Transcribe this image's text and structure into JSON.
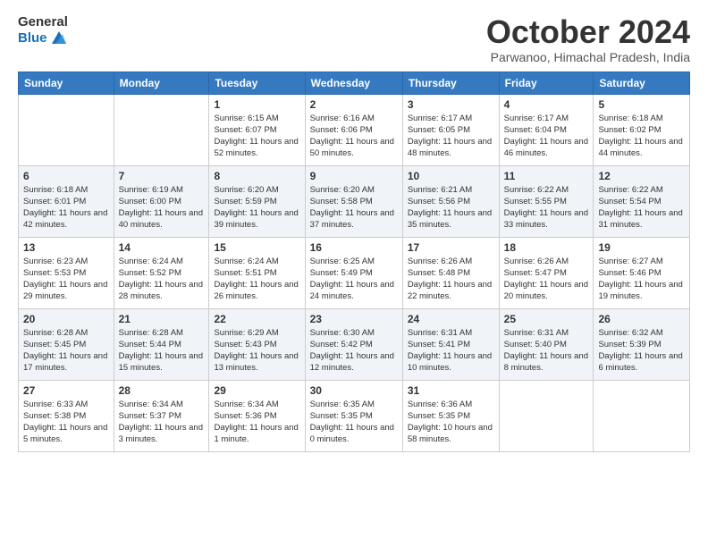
{
  "logo": {
    "general": "General",
    "blue": "Blue"
  },
  "header": {
    "month": "October 2024",
    "location": "Parwanoo, Himachal Pradesh, India"
  },
  "weekdays": [
    "Sunday",
    "Monday",
    "Tuesday",
    "Wednesday",
    "Thursday",
    "Friday",
    "Saturday"
  ],
  "weeks": [
    [
      {
        "day": "",
        "sunrise": "",
        "sunset": "",
        "daylight": ""
      },
      {
        "day": "",
        "sunrise": "",
        "sunset": "",
        "daylight": ""
      },
      {
        "day": "1",
        "sunrise": "Sunrise: 6:15 AM",
        "sunset": "Sunset: 6:07 PM",
        "daylight": "Daylight: 11 hours and 52 minutes."
      },
      {
        "day": "2",
        "sunrise": "Sunrise: 6:16 AM",
        "sunset": "Sunset: 6:06 PM",
        "daylight": "Daylight: 11 hours and 50 minutes."
      },
      {
        "day": "3",
        "sunrise": "Sunrise: 6:17 AM",
        "sunset": "Sunset: 6:05 PM",
        "daylight": "Daylight: 11 hours and 48 minutes."
      },
      {
        "day": "4",
        "sunrise": "Sunrise: 6:17 AM",
        "sunset": "Sunset: 6:04 PM",
        "daylight": "Daylight: 11 hours and 46 minutes."
      },
      {
        "day": "5",
        "sunrise": "Sunrise: 6:18 AM",
        "sunset": "Sunset: 6:02 PM",
        "daylight": "Daylight: 11 hours and 44 minutes."
      }
    ],
    [
      {
        "day": "6",
        "sunrise": "Sunrise: 6:18 AM",
        "sunset": "Sunset: 6:01 PM",
        "daylight": "Daylight: 11 hours and 42 minutes."
      },
      {
        "day": "7",
        "sunrise": "Sunrise: 6:19 AM",
        "sunset": "Sunset: 6:00 PM",
        "daylight": "Daylight: 11 hours and 40 minutes."
      },
      {
        "day": "8",
        "sunrise": "Sunrise: 6:20 AM",
        "sunset": "Sunset: 5:59 PM",
        "daylight": "Daylight: 11 hours and 39 minutes."
      },
      {
        "day": "9",
        "sunrise": "Sunrise: 6:20 AM",
        "sunset": "Sunset: 5:58 PM",
        "daylight": "Daylight: 11 hours and 37 minutes."
      },
      {
        "day": "10",
        "sunrise": "Sunrise: 6:21 AM",
        "sunset": "Sunset: 5:56 PM",
        "daylight": "Daylight: 11 hours and 35 minutes."
      },
      {
        "day": "11",
        "sunrise": "Sunrise: 6:22 AM",
        "sunset": "Sunset: 5:55 PM",
        "daylight": "Daylight: 11 hours and 33 minutes."
      },
      {
        "day": "12",
        "sunrise": "Sunrise: 6:22 AM",
        "sunset": "Sunset: 5:54 PM",
        "daylight": "Daylight: 11 hours and 31 minutes."
      }
    ],
    [
      {
        "day": "13",
        "sunrise": "Sunrise: 6:23 AM",
        "sunset": "Sunset: 5:53 PM",
        "daylight": "Daylight: 11 hours and 29 minutes."
      },
      {
        "day": "14",
        "sunrise": "Sunrise: 6:24 AM",
        "sunset": "Sunset: 5:52 PM",
        "daylight": "Daylight: 11 hours and 28 minutes."
      },
      {
        "day": "15",
        "sunrise": "Sunrise: 6:24 AM",
        "sunset": "Sunset: 5:51 PM",
        "daylight": "Daylight: 11 hours and 26 minutes."
      },
      {
        "day": "16",
        "sunrise": "Sunrise: 6:25 AM",
        "sunset": "Sunset: 5:49 PM",
        "daylight": "Daylight: 11 hours and 24 minutes."
      },
      {
        "day": "17",
        "sunrise": "Sunrise: 6:26 AM",
        "sunset": "Sunset: 5:48 PM",
        "daylight": "Daylight: 11 hours and 22 minutes."
      },
      {
        "day": "18",
        "sunrise": "Sunrise: 6:26 AM",
        "sunset": "Sunset: 5:47 PM",
        "daylight": "Daylight: 11 hours and 20 minutes."
      },
      {
        "day": "19",
        "sunrise": "Sunrise: 6:27 AM",
        "sunset": "Sunset: 5:46 PM",
        "daylight": "Daylight: 11 hours and 19 minutes."
      }
    ],
    [
      {
        "day": "20",
        "sunrise": "Sunrise: 6:28 AM",
        "sunset": "Sunset: 5:45 PM",
        "daylight": "Daylight: 11 hours and 17 minutes."
      },
      {
        "day": "21",
        "sunrise": "Sunrise: 6:28 AM",
        "sunset": "Sunset: 5:44 PM",
        "daylight": "Daylight: 11 hours and 15 minutes."
      },
      {
        "day": "22",
        "sunrise": "Sunrise: 6:29 AM",
        "sunset": "Sunset: 5:43 PM",
        "daylight": "Daylight: 11 hours and 13 minutes."
      },
      {
        "day": "23",
        "sunrise": "Sunrise: 6:30 AM",
        "sunset": "Sunset: 5:42 PM",
        "daylight": "Daylight: 11 hours and 12 minutes."
      },
      {
        "day": "24",
        "sunrise": "Sunrise: 6:31 AM",
        "sunset": "Sunset: 5:41 PM",
        "daylight": "Daylight: 11 hours and 10 minutes."
      },
      {
        "day": "25",
        "sunrise": "Sunrise: 6:31 AM",
        "sunset": "Sunset: 5:40 PM",
        "daylight": "Daylight: 11 hours and 8 minutes."
      },
      {
        "day": "26",
        "sunrise": "Sunrise: 6:32 AM",
        "sunset": "Sunset: 5:39 PM",
        "daylight": "Daylight: 11 hours and 6 minutes."
      }
    ],
    [
      {
        "day": "27",
        "sunrise": "Sunrise: 6:33 AM",
        "sunset": "Sunset: 5:38 PM",
        "daylight": "Daylight: 11 hours and 5 minutes."
      },
      {
        "day": "28",
        "sunrise": "Sunrise: 6:34 AM",
        "sunset": "Sunset: 5:37 PM",
        "daylight": "Daylight: 11 hours and 3 minutes."
      },
      {
        "day": "29",
        "sunrise": "Sunrise: 6:34 AM",
        "sunset": "Sunset: 5:36 PM",
        "daylight": "Daylight: 11 hours and 1 minute."
      },
      {
        "day": "30",
        "sunrise": "Sunrise: 6:35 AM",
        "sunset": "Sunset: 5:35 PM",
        "daylight": "Daylight: 11 hours and 0 minutes."
      },
      {
        "day": "31",
        "sunrise": "Sunrise: 6:36 AM",
        "sunset": "Sunset: 5:35 PM",
        "daylight": "Daylight: 10 hours and 58 minutes."
      },
      {
        "day": "",
        "sunrise": "",
        "sunset": "",
        "daylight": ""
      },
      {
        "day": "",
        "sunrise": "",
        "sunset": "",
        "daylight": ""
      }
    ]
  ]
}
